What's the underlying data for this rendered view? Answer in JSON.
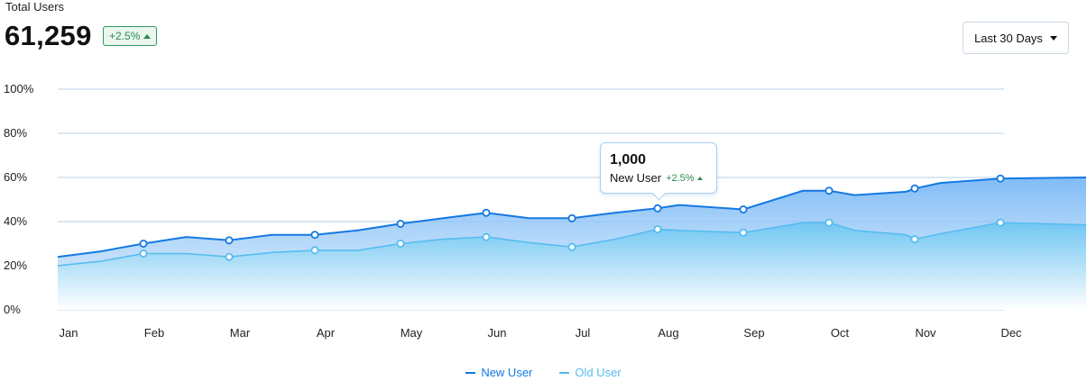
{
  "header": {
    "title": "Total Users",
    "value": "61,259",
    "change": "+2.5%"
  },
  "controls": {
    "range_label": "Last 30 Days"
  },
  "tooltip": {
    "value": "1,000",
    "series": "New User",
    "change": "+2.5%"
  },
  "colors": {
    "new_user": "#1479e2",
    "old_user": "#55bdf0",
    "grid": "#b8d2e6",
    "positive": "#2e8a50"
  },
  "chart_data": {
    "type": "area",
    "categories": [
      "Jan",
      "Feb",
      "Mar",
      "Apr",
      "May",
      "Jun",
      "Jul",
      "Aug",
      "Sep",
      "Oct",
      "Nov",
      "Dec"
    ],
    "x_positions": [
      0,
      0.5,
      1,
      1.5,
      2,
      2.5,
      3,
      3.5,
      4,
      4.5,
      5,
      5.5,
      6,
      6.5,
      7,
      7.25,
      8,
      8.7,
      9,
      9.3,
      9.9,
      10,
      10.3,
      11,
      12
    ],
    "y_ticks": [
      "0%",
      "20%",
      "40%",
      "60%",
      "80%",
      "100%"
    ],
    "ylim": [
      0,
      100
    ],
    "grid": true,
    "legend_position": "bottom-center",
    "series": [
      {
        "name": "New User",
        "values": [
          24,
          26.5,
          30,
          33,
          31.5,
          34,
          34,
          36,
          39,
          41.5,
          44,
          41.5,
          41.5,
          44,
          46,
          47.5,
          45.5,
          54,
          54,
          52,
          53.5,
          55,
          57.5,
          59.5,
          60
        ],
        "markers": [
          2,
          4,
          6,
          8,
          10,
          12,
          14,
          16,
          18,
          21,
          23
        ]
      },
      {
        "name": "Old User",
        "values": [
          20,
          22,
          25.5,
          25.5,
          24,
          26,
          27,
          27,
          30,
          32,
          33,
          30.5,
          28.5,
          32,
          36.5,
          36,
          35,
          39.5,
          39.5,
          36,
          34,
          32,
          34.5,
          39.5,
          38.5
        ],
        "markers": [
          2,
          4,
          6,
          8,
          10,
          12,
          14,
          16,
          18,
          21,
          23
        ]
      }
    ],
    "highlight": {
      "series": "New User",
      "category": "Aug",
      "value": "1,000",
      "change": "+2.5%"
    }
  }
}
